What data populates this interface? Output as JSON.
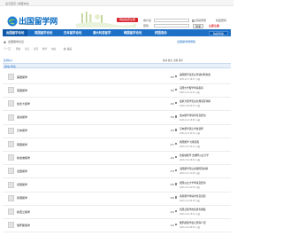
{
  "topbar": {
    "text": "设为首页 | 收藏本站"
  },
  "brand": {
    "logo_text": "出国留学网",
    "logo_sub": "www.liuxue86.com",
    "color": "#0a6cc2"
  },
  "banner": {
    "button_label": "网站免费注册"
  },
  "login": {
    "user_label": "用户名",
    "remember_label": "自动登录",
    "forgot_label": "找回密码",
    "pass_label": "密码",
    "login_button": "登录",
    "register_link": "立即注册"
  },
  "nav": {
    "items": [
      "出国留学论坛",
      "美国留学论坛",
      "日本留学论坛",
      "澳大利亚留学",
      "韩国留学论坛",
      "校园活动"
    ],
    "right_label": "快捷导航",
    "color": "#1e6fc6"
  },
  "breadcrumb": {
    "text": "出国留学论坛",
    "sub_link": "出国留学网博客"
  },
  "tools": {
    "groups": [
      "下一页",
      "网站",
      "论坛",
      "资讯",
      "精华",
      "热帖"
    ],
    "right": "帖: 最后"
  },
  "subnav": {
    "left": "最新帖子",
    "right": "版块  版主  主题  排序"
  },
  "list_header": "版块 列表",
  "forums": [
    {
      "name": "美国留学",
      "count": "326",
      "title": "美国留学生签证申请材料准备",
      "meta": "2023-3-17 18:47 小编"
    },
    {
      "name": "英国留学",
      "count": "190",
      "title": "英国大学留学申请指南",
      "meta": "2023-3-16 11:22 小编"
    },
    {
      "name": "加拿大留学",
      "count": "165",
      "title": "加拿大留学签证办理流程详解",
      "meta": "2023-3-15 09:34 小编"
    },
    {
      "name": "澳洲留学",
      "count": "150",
      "title": "澳洲留学申请条件及费用",
      "meta": "2023-3-14 16:05 小编"
    },
    {
      "name": "日本留学",
      "count": "133",
      "title": "日本留学语言学校选择",
      "meta": "2023-3-13 14:40 小编"
    },
    {
      "name": "韩国留学",
      "count": "247",
      "title": "韩国留学 大概流程",
      "meta": "2023-3-13 10:12 小编"
    },
    {
      "name": "新加坡留学",
      "count": "119",
      "title": "新加坡留学 去哪所公立大学",
      "meta": "2023-3-12 18:20 小编"
    },
    {
      "name": "法国留学",
      "count": "278",
      "title": "法国留学签证办理所需材料",
      "meta": "2023-3-12 11:06 小编"
    },
    {
      "name": "德国留学",
      "count": "255",
      "title": "德国公立大学申请及费用",
      "meta": "2023-3-11 20:45 小编"
    },
    {
      "name": "香港留学",
      "count": "309",
      "title": "香港留学申请条件及流程",
      "meta": "2023-3-11 09:18 小编"
    },
    {
      "name": "新西兰留学",
      "count": "216",
      "title": "新西兰留学的优势有哪些",
      "meta": "2023-3-10 15:30 小编"
    },
    {
      "name": "俄罗斯留学",
      "count": "142",
      "title": "俄罗斯留学语言预科介绍",
      "meta": "2023-3-10 08:52 小编"
    }
  ]
}
